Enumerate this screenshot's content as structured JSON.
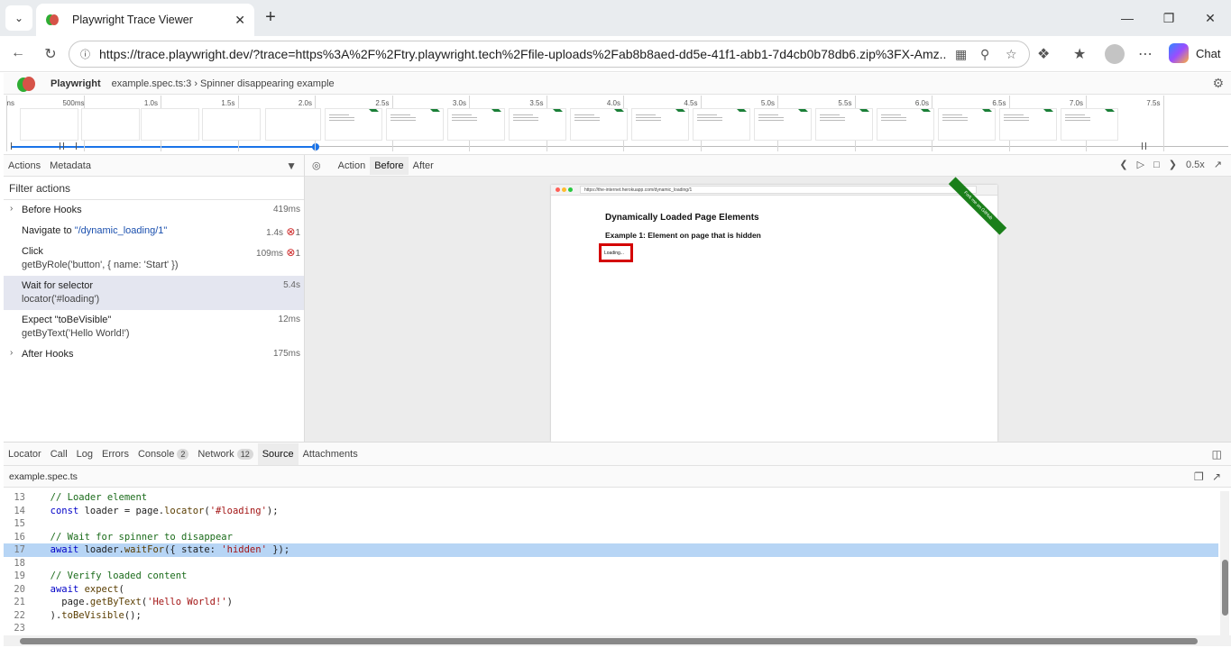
{
  "browser": {
    "tab_title": "Playwright Trace Viewer",
    "url": "https://trace.playwright.dev/?trace=https%3A%2F%2Ftry.playwright.tech%2Ffile-uploads%2Fab8b8aed-dd5e-41f1-abb1-7d4cb0b78db6.zip%3FX-Amz...",
    "chat_label": "Chat"
  },
  "header": {
    "brand": "Playwright",
    "breadcrumb": "example.spec.ts:3 › Spinner disappearing example"
  },
  "timeline": {
    "ticks": [
      "ns",
      "500ms",
      "1.0s",
      "1.5s",
      "2.0s",
      "2.5s",
      "3.0s",
      "3.5s",
      "4.0s",
      "4.5s",
      "5.0s",
      "5.5s",
      "6.0s",
      "6.5s",
      "7.0s",
      "7.5s"
    ]
  },
  "left_tabs": [
    "Actions",
    "Metadata"
  ],
  "filter_placeholder": "Filter actions",
  "actions": [
    {
      "name": "Before Hooks",
      "sub": "",
      "dur": "419ms",
      "err": "",
      "group": true
    },
    {
      "name": "Navigate to ",
      "url": "\"/dynamic_loading/1\"",
      "sub": "",
      "dur": "1.4s",
      "err": "1"
    },
    {
      "name": "Click",
      "sub": "getByRole('button', { name: 'Start' })",
      "dur": "109ms",
      "err": "1"
    },
    {
      "name": "Wait for selector",
      "sub": "locator('#loading')",
      "dur": "5.4s",
      "err": "",
      "selected": true
    },
    {
      "name": "Expect \"toBeVisible\"",
      "sub": "getByText('Hello World!')",
      "dur": "12ms",
      "err": ""
    },
    {
      "name": "After Hooks",
      "sub": "",
      "dur": "175ms",
      "err": "",
      "group": true
    }
  ],
  "right_tabs": {
    "action": "Action",
    "before": "Before",
    "after": "After"
  },
  "speed": "0.5x",
  "snapshot": {
    "url": "https://the-internet.herokuapp.com/dynamic_loading/1",
    "heading": "Dynamically Loaded Page Elements",
    "subheading": "Example 1: Element on page that is hidden",
    "loading": "Loading...",
    "ribbon": "Fork me on GitHub"
  },
  "bottom_tabs": [
    {
      "label": "Locator",
      "badge": ""
    },
    {
      "label": "Call",
      "badge": ""
    },
    {
      "label": "Log",
      "badge": ""
    },
    {
      "label": "Errors",
      "badge": ""
    },
    {
      "label": "Console",
      "badge": "2"
    },
    {
      "label": "Network",
      "badge": "12"
    },
    {
      "label": "Source",
      "badge": "",
      "active": true
    },
    {
      "label": "Attachments",
      "badge": ""
    }
  ],
  "source_file": "example.spec.ts",
  "code": [
    {
      "n": "13",
      "html": "  <span class='c-com'>// Loader element</span>"
    },
    {
      "n": "14",
      "html": "  <span class='c-kw'>const</span> loader = page.<span class='c-fn'>locator</span>(<span class='c-str'>'#loading'</span>);"
    },
    {
      "n": "15",
      "html": ""
    },
    {
      "n": "16",
      "html": "  <span class='c-com'>// Wait for spinner to disappear</span>"
    },
    {
      "n": "17",
      "html": "  <span class='c-kw'>await</span> loader.<span class='c-fn'>waitFor</span>({ state: <span class='c-str'>'hidden'</span> });",
      "hl": true
    },
    {
      "n": "18",
      "html": ""
    },
    {
      "n": "19",
      "html": "  <span class='c-com'>// Verify loaded content</span>"
    },
    {
      "n": "20",
      "html": "  <span class='c-kw'>await</span> <span class='c-fn'>expect</span>("
    },
    {
      "n": "21",
      "html": "    page.<span class='c-fn'>getByText</span>(<span class='c-str'>'Hello World!'</span>)"
    },
    {
      "n": "22",
      "html": "  ).<span class='c-fn'>toBeVisible</span>();"
    },
    {
      "n": "23",
      "html": ""
    }
  ]
}
